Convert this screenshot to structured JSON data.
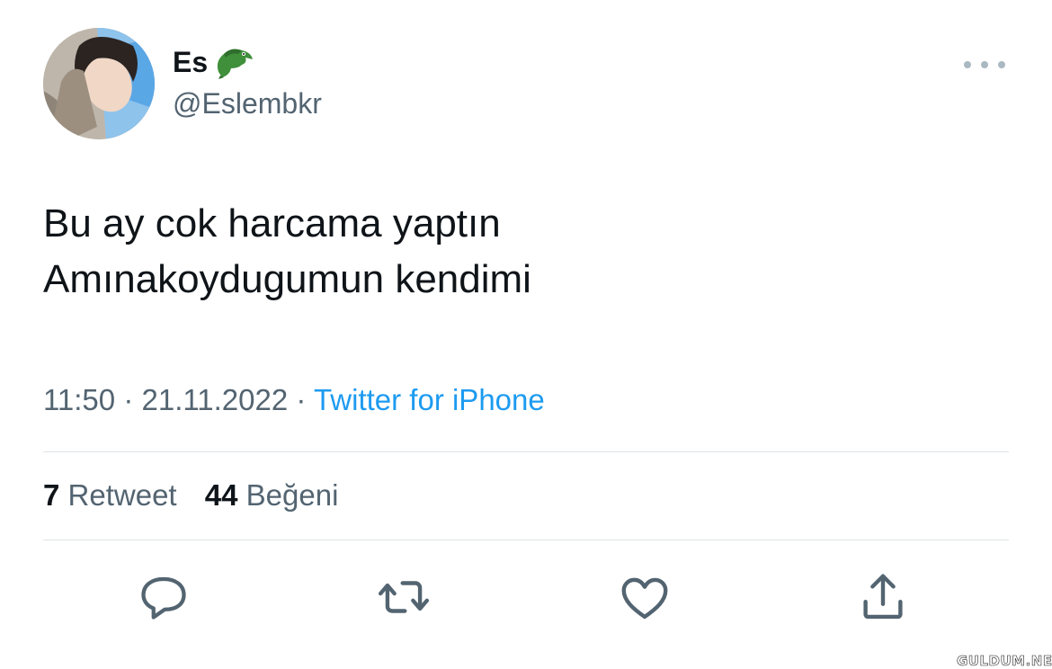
{
  "author": {
    "display_name": "Es",
    "name_emoji_icon": "crocodile-icon",
    "handle": "@Eslembkr",
    "avatar_icon": "profile-photo"
  },
  "tweet": {
    "lines": [
      "Bu ay cok harcama yaptın",
      "Amınakoydugumun kendimi"
    ],
    "time": "11:50",
    "separator": "·",
    "date": "21.11.2022",
    "source": "Twitter for iPhone"
  },
  "stats": {
    "retweets_count": "7",
    "retweets_label": "Retweet",
    "likes_count": "44",
    "likes_label": "Beğeni"
  },
  "actions": [
    "reply-icon",
    "retweet-icon",
    "like-icon",
    "share-icon"
  ],
  "watermark": "GULDUM.NET",
  "colors": {
    "text": "#0f1419",
    "secondary": "#536471",
    "link": "#1d9bf0",
    "icon": "#536471",
    "divider": "#dfe3e6"
  }
}
